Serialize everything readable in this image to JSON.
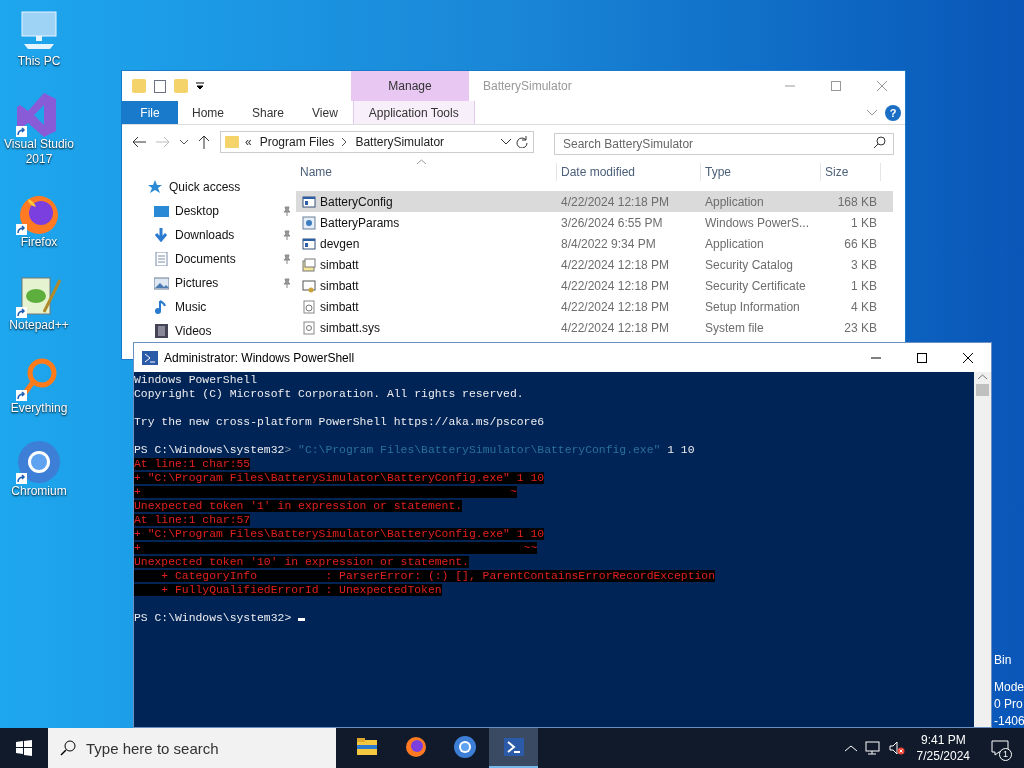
{
  "desktop_icons": [
    {
      "kind": "pc",
      "label": "This PC",
      "shortcut": false
    },
    {
      "kind": "vs",
      "label": "Visual Studio 2017",
      "shortcut": true
    },
    {
      "kind": "firefox",
      "label": "Firefox",
      "shortcut": true
    },
    {
      "kind": "notepad",
      "label": "Notepad++",
      "shortcut": true
    },
    {
      "kind": "everything",
      "label": "Everything",
      "shortcut": true
    },
    {
      "kind": "chromium",
      "label": "Chromium",
      "shortcut": true
    }
  ],
  "desktop_edge_texts": [
    "Bin",
    "Mode",
    "0 Pro",
    "-1406"
  ],
  "explorer": {
    "title": "BatterySimulator",
    "context_tab": "Manage",
    "ribbon_tabs": [
      {
        "label": "File",
        "kind": "file"
      },
      {
        "label": "Home",
        "kind": "tab"
      },
      {
        "label": "Share",
        "kind": "tab"
      },
      {
        "label": "View",
        "kind": "tab"
      },
      {
        "label": "Application Tools",
        "kind": "context"
      }
    ],
    "help_glyph": "?",
    "overflow_glyph": "«",
    "path": [
      "Program Files",
      "BatterySimulator"
    ],
    "search": {
      "placeholder": "Search BatterySimulator"
    },
    "columns": [
      "Name",
      "Date modified",
      "Type",
      "Size"
    ],
    "sidebar": [
      {
        "label": "Quick access",
        "kind": "star",
        "pinned": false
      },
      {
        "label": "Desktop",
        "kind": "desktop",
        "pinned": true
      },
      {
        "label": "Downloads",
        "kind": "download",
        "pinned": true
      },
      {
        "label": "Documents",
        "kind": "document",
        "pinned": true
      },
      {
        "label": "Pictures",
        "kind": "picture",
        "pinned": true
      },
      {
        "label": "Music",
        "kind": "music",
        "pinned": false
      },
      {
        "label": "Videos",
        "kind": "video",
        "pinned": false
      }
    ],
    "rows": [
      {
        "kind": "app",
        "name": "BatteryConfig",
        "date": "4/22/2024 12:18 PM",
        "type": "Application",
        "size": "168 KB",
        "selected": true
      },
      {
        "kind": "script",
        "name": "BatteryParams",
        "date": "3/26/2024 6:55 PM",
        "type": "Windows PowerS...",
        "size": "1 KB",
        "selected": false
      },
      {
        "kind": "app",
        "name": "devgen",
        "date": "8/4/2022 9:34 PM",
        "type": "Application",
        "size": "66 KB",
        "selected": false
      },
      {
        "kind": "catalog",
        "name": "simbatt",
        "date": "4/22/2024 12:18 PM",
        "type": "Security Catalog",
        "size": "3 KB",
        "selected": false
      },
      {
        "kind": "cert",
        "name": "simbatt",
        "date": "4/22/2024 12:18 PM",
        "type": "Security Certificate",
        "size": "1 KB",
        "selected": false
      },
      {
        "kind": "setup",
        "name": "simbatt",
        "date": "4/22/2024 12:18 PM",
        "type": "Setup Information",
        "size": "4 KB",
        "selected": false
      },
      {
        "kind": "sys",
        "name": "simbatt.sys",
        "date": "4/22/2024 12:18 PM",
        "type": "System file",
        "size": "23 KB",
        "selected": false
      }
    ]
  },
  "powershell": {
    "title": "Administrator: Windows PowerShell",
    "lines": [
      {
        "kind": "out",
        "text": "Windows PowerShell"
      },
      {
        "kind": "out",
        "text": "Copyright (C) Microsoft Corporation. All rights reserved."
      },
      {
        "kind": "blank"
      },
      {
        "kind": "out",
        "text": "Try the new cross-platform PowerShell https://aka.ms/pscore6"
      },
      {
        "kind": "blank"
      },
      {
        "kind": "command",
        "prompt": "PS C:\\Windows\\system32",
        "operator": ">",
        "string": "\"C:\\Program Files\\BatterySimulator\\BatteryConfig.exe\"",
        "args": "1 10"
      },
      {
        "kind": "error",
        "text": "At line:1 char:55"
      },
      {
        "kind": "error",
        "text": "+ \"C:\\Program Files\\BatterySimulator\\BatteryConfig.exe\" 1 10"
      },
      {
        "kind": "error",
        "text": "+                                                      ~"
      },
      {
        "kind": "error",
        "text": "Unexpected token '1' in expression or statement."
      },
      {
        "kind": "error",
        "text": "At line:1 char:57"
      },
      {
        "kind": "error",
        "text": "+ \"C:\\Program Files\\BatterySimulator\\BatteryConfig.exe\" 1 10"
      },
      {
        "kind": "error",
        "text": "+                                                        ~~"
      },
      {
        "kind": "error",
        "text": "Unexpected token '10' in expression or statement."
      },
      {
        "kind": "error",
        "text": "    + CategoryInfo          : ParserError: (:) [], ParentContainsErrorRecordException"
      },
      {
        "kind": "error",
        "text": "    + FullyQualifiedErrorId : UnexpectedToken"
      },
      {
        "kind": "blank"
      },
      {
        "kind": "prompt",
        "text": "PS C:\\Windows\\system32>"
      }
    ]
  },
  "taskbar": {
    "search": {
      "placeholder": "Type here to search"
    },
    "apps": [
      {
        "kind": "explorer",
        "active": false
      },
      {
        "kind": "firefox",
        "active": false
      },
      {
        "kind": "chromium",
        "active": false
      },
      {
        "kind": "powershell",
        "active": true
      }
    ],
    "time": "9:41 PM",
    "date": "7/25/2024",
    "notifications": "1"
  }
}
